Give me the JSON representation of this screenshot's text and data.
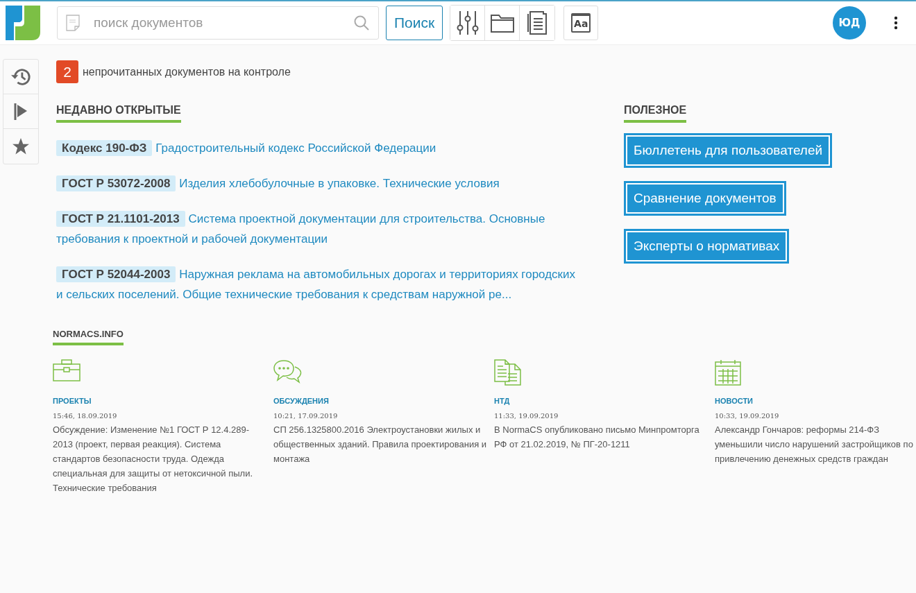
{
  "header": {
    "search": {
      "placeholder": "поиск документов"
    },
    "search_button": "Поиск",
    "font_button": "Aa",
    "avatar": "ЮД"
  },
  "control_notice": {
    "count": "2",
    "text": "непрочитанных документов на контроле"
  },
  "recent": {
    "title": "НЕДАВНО ОТКРЫТЫЕ",
    "items": [
      {
        "code": "Кодекс 190-ФЗ",
        "title": "Градостроительный кодекс Российской Федерации"
      },
      {
        "code": "ГОСТ Р 53072-2008",
        "title": "Изделия хлебобулочные в упаковке. Технические условия"
      },
      {
        "code": "ГОСТ Р 21.1101-2013",
        "title": "Система проектной документации для строительства. Основные требования к проектной и рабочей документации"
      },
      {
        "code": "ГОСТ Р 52044-2003",
        "title": "Наружная реклама на автомобильных дорогах и территориях городских и сельских поселений. Общие технические требования к средствам наружной ре..."
      }
    ]
  },
  "useful": {
    "title": "ПОЛЕЗНОЕ",
    "buttons": [
      "Бюллетень для пользователей",
      "Сравнение документов",
      "Эксперты о нормативах"
    ]
  },
  "news": {
    "title": "NORMACS.INFO",
    "columns": [
      {
        "kind": "briefcase",
        "category": "ПРОЕКТЫ",
        "time": "15:46, 18.09.2019",
        "text": "Обсуждение: Изменение №1 ГОСТ Р 12.4.289-2013 (проект, первая реакция). Система стандартов безопасности труда. Одежда специальная для защиты от нетоксичной пыли. Технические требования"
      },
      {
        "kind": "chat",
        "category": "ОБСУЖДЕНИЯ",
        "time": "10:21, 17.09.2019",
        "text": "СП 256.1325800.2016 Электроустановки жилых и общественных зданий. Правила проектирования и монтажа"
      },
      {
        "kind": "documents",
        "category": "НТД",
        "time": "11:33, 19.09.2019",
        "text": "В NormaCS опубликовано письмо Минпромторга РФ от 21.02.2019, № ПГ-20-1211"
      },
      {
        "kind": "calendar",
        "category": "НОВОСТИ",
        "time": "10:33, 19.09.2019",
        "text": "Александр Гончаров: реформы 214-ФЗ уменьшили число нарушений застройщиков по привлечению денежных средств граждан"
      }
    ]
  }
}
